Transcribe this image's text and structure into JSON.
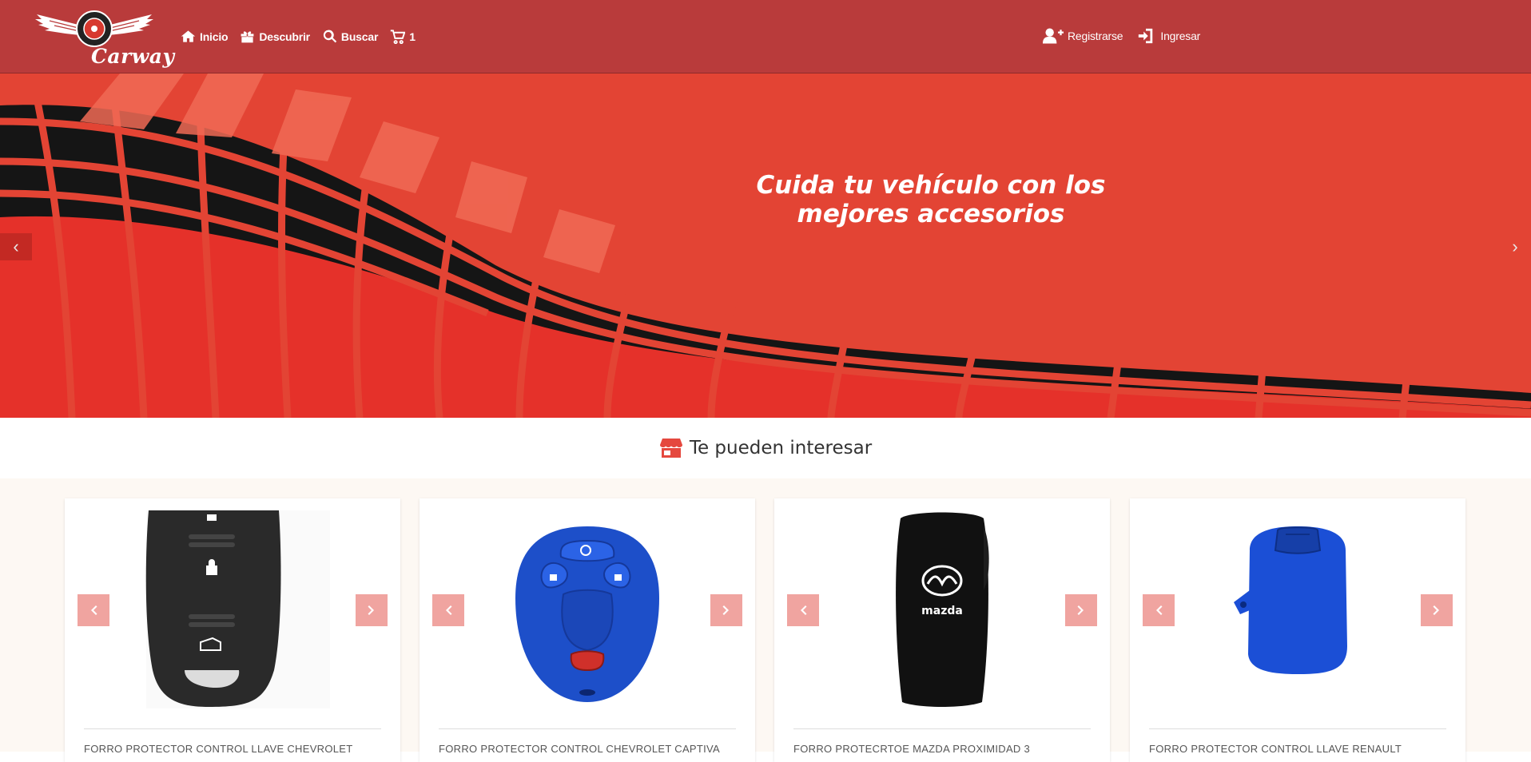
{
  "brand": {
    "name": "Carway"
  },
  "nav": {
    "items": [
      {
        "label": "Inicio",
        "icon": "home-icon"
      },
      {
        "label": "Descubrir",
        "icon": "gift-icon"
      },
      {
        "label": "Buscar",
        "icon": "search-icon"
      },
      {
        "label": "1",
        "icon": "cart-icon"
      }
    ],
    "right": [
      {
        "label": "Registrarse",
        "icon": "user-plus-icon"
      },
      {
        "label": "Ingresar",
        "icon": "sign-in-icon"
      }
    ]
  },
  "hero": {
    "caption": "Cuida tu vehículo con los mejores accesorios",
    "prev_icon": "chevron-left-icon",
    "next_icon": "chevron-right-icon"
  },
  "section": {
    "title": "Te pueden interesar",
    "icon": "store-icon"
  },
  "products": [
    {
      "name": "FORRO PROTECTOR CONTROL LLAVE CHEVROLET",
      "color": "#2a2a2a"
    },
    {
      "name": "FORRO PROTECTOR CONTROL CHEVROLET CAPTIVA",
      "color": "#1d4fc9"
    },
    {
      "name": "FORRO PROTECRTOE MAZDA PROXIMIDAD 3",
      "color": "#111111"
    },
    {
      "name": "FORRO PROTECTOR CONTROL LLAVE RENAULT",
      "color": "#1b4fd6"
    }
  ],
  "colors": {
    "navbar": "#b93b3b",
    "hero": "#e34434",
    "accent_btn": "#f0a4a0",
    "section_bg": "#fdf8f3"
  }
}
